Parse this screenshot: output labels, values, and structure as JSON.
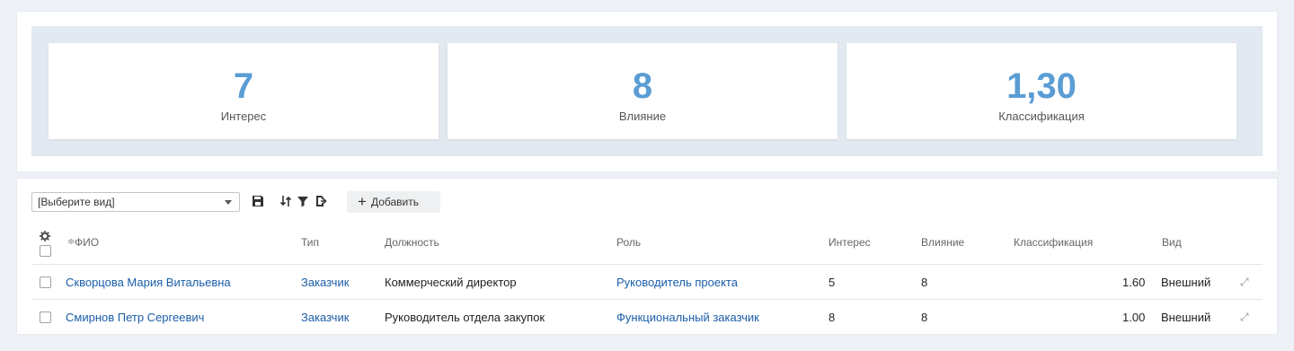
{
  "metrics": [
    {
      "value": "7",
      "label": "Интерес"
    },
    {
      "value": "8",
      "label": "Влияние"
    },
    {
      "value": "1,30",
      "label": "Классификация"
    }
  ],
  "toolbar": {
    "view_select_value": "[Выберите вид]",
    "add_label": "Добавить",
    "add_symbol": "+"
  },
  "table": {
    "columns": {
      "fio": "ФИО",
      "type": "Тип",
      "position": "Должность",
      "role": "Роль",
      "interest": "Интерес",
      "influence": "Влияние",
      "classification": "Классификация",
      "view": "Вид"
    },
    "sort_indicator": "≑",
    "rows": [
      {
        "fio": "Скворцова Мария Витальевна",
        "type": "Заказчик",
        "position": "Коммерческий директор",
        "role": "Руководитель проекта",
        "interest": "5",
        "influence": "8",
        "classification": "1.60",
        "view": "Внешний",
        "action": "⤢"
      },
      {
        "fio": "Смирнов Петр Сергеевич",
        "type": "Заказчик",
        "position": "Руководитель отдела закупок",
        "role": "Функциональный заказчик",
        "interest": "8",
        "influence": "8",
        "classification": "1.00",
        "view": "Внешний",
        "action": "⤢"
      }
    ]
  },
  "colors": {
    "accent": "#5a9dd5",
    "link": "#1a5ea8",
    "page_bg": "#edf1f5"
  }
}
